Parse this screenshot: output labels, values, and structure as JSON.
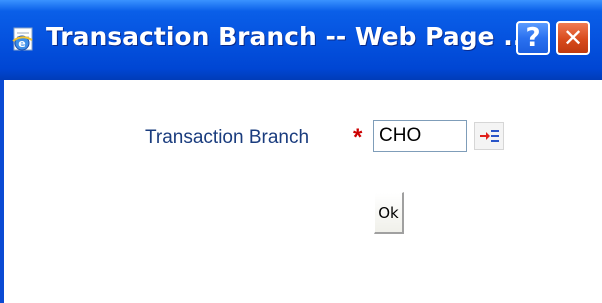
{
  "window": {
    "title": "Transaction Branch -- Web Page ...",
    "help_label": "?",
    "close_label": "✕"
  },
  "form": {
    "field_label": "Transaction Branch",
    "required_marker": "*",
    "branch_value": "CHO",
    "ok_label": "Ok"
  },
  "icons": {
    "title_icon": "ie-page-icon",
    "lov_icon": "list-of-values-icon"
  },
  "colors": {
    "titlebar": "#0552df",
    "label_text": "#1a3c7e",
    "required": "#cc0000",
    "close_button": "#d84b1c"
  }
}
